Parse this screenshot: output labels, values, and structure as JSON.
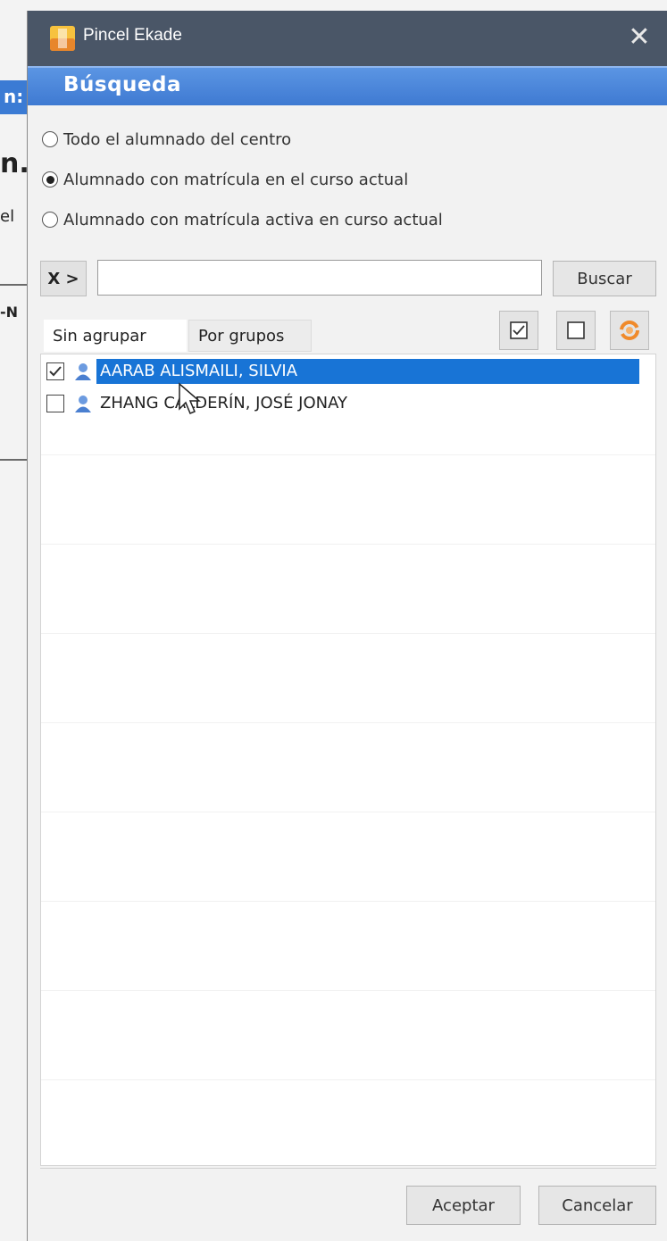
{
  "background": {
    "fragments": [
      "n:",
      "n.",
      "el",
      "-N"
    ]
  },
  "window": {
    "title": "Pincel Ekade",
    "close_glyph": "✕",
    "app_icon": "pincel-ekade-app-icon"
  },
  "header": {
    "title": "Búsqueda"
  },
  "scope": {
    "options": [
      {
        "label": "Todo el alumnado del centro",
        "selected": false
      },
      {
        "label": "Alumnado con matrícula en el curso actual",
        "selected": true
      },
      {
        "label": "Alumnado con matrícula activa en curso actual",
        "selected": false
      }
    ]
  },
  "search": {
    "prefix_label": "X >",
    "value": "",
    "placeholder": "",
    "button_label": "Buscar"
  },
  "tabs": [
    {
      "label": "Sin agrupar",
      "active": true
    },
    {
      "label": "Por grupos",
      "active": false
    }
  ],
  "toolbar": {
    "icons": [
      "check-all-icon",
      "uncheck-all-icon",
      "refresh-icon"
    ]
  },
  "students": [
    {
      "name": "AARAB ALISMAILI, SILVIA",
      "checked": true,
      "selected": true
    },
    {
      "name": "ZHANG CALDERÍN, JOSÉ JONAY",
      "checked": false,
      "selected": false
    }
  ],
  "footer": {
    "accept_label": "Aceptar",
    "cancel_label": "Cancelar"
  },
  "colors": {
    "titlebar": "#4a5667",
    "header": "#3f7ad2",
    "selection": "#1874d6"
  }
}
